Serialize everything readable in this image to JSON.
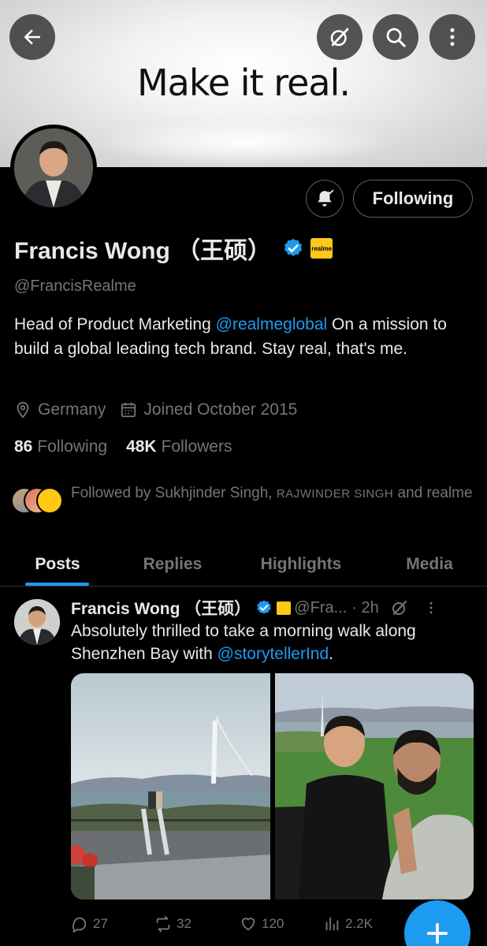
{
  "banner": {
    "text": "Make it real."
  },
  "header": {
    "back_icon": "back-arrow-icon",
    "mute_icon": "grok-icon",
    "search_icon": "search-icon",
    "more_icon": "more-vertical-icon"
  },
  "profile": {
    "name": "Francis Wong （王硕）",
    "handle": "@FrancisRealme",
    "badge_label": "realme",
    "follow_button": "Following",
    "bio_prefix": "Head of Product Marketing ",
    "bio_link": "@realmeglobal",
    "bio_suffix": " On a mission to build a global leading tech brand.  Stay real, that's me.",
    "location": "Germany",
    "joined": "Joined October 2015",
    "following_count": "86",
    "following_label": "Following",
    "followers_count": "48K",
    "followers_label": "Followers",
    "followed_by_prefix": "Followed by Sukhjinder Singh, ",
    "followed_by_caps": "RAJWINDER SINGH",
    "followed_by_suffix": " and realme"
  },
  "tabs": [
    {
      "label": "Posts",
      "active": true
    },
    {
      "label": "Replies",
      "active": false
    },
    {
      "label": "Highlights",
      "active": false
    },
    {
      "label": "Media",
      "active": false
    }
  ],
  "post": {
    "author": "Francis Wong （王硕）",
    "handle": "@Fra...",
    "time": "· 2h",
    "text_prefix": "Absolutely thrilled to take a morning walk along Shenzhen Bay with ",
    "text_link": "@storytellerInd",
    "text_suffix": ".",
    "replies": "27",
    "reposts": "32",
    "likes": "120",
    "views": "2.2K"
  },
  "colors": {
    "accent": "#1d9bf0",
    "muted": "#71767b",
    "badge_yellow": "#ffc915"
  }
}
